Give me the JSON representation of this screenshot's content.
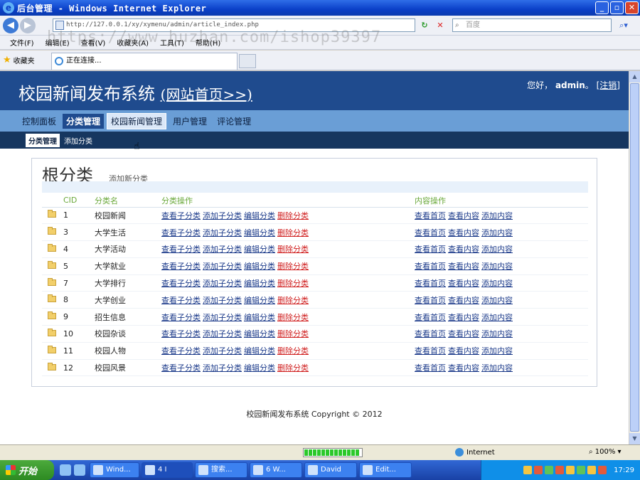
{
  "window": {
    "title": "后台管理 - Windows Internet Explorer",
    "address": "http://127.0.0.1/xy/xymenu/admin/article_index.php",
    "search_placeholder": "百度",
    "watermark": "https://www.huzhan.com/ishop39397",
    "menu": [
      "文件(F)",
      "编辑(E)",
      "查看(V)",
      "收藏夹(A)",
      "工具(T)",
      "帮助(H)"
    ],
    "favorites_label": "收藏夹",
    "tab_label": "正在连接...",
    "status_zone": "Internet",
    "zoom": "100%"
  },
  "site": {
    "title": "校园新闻发布系统",
    "home_link": "(网站首页>>)",
    "greeting": "您好，",
    "user": "admin",
    "logout": "[注销]",
    "nav": [
      "控制面板",
      "分类管理",
      "校园新闻管理",
      "用户管理",
      "评论管理"
    ],
    "subnav": [
      "分类管理",
      "添加分类"
    ],
    "panel_title": "根分类",
    "panel_add": "添加新分类",
    "columns": [
      "CID",
      "分类名",
      "分类操作",
      "内容操作"
    ],
    "cat_actions": [
      "查看子分类",
      "添加子分类",
      "编辑分类",
      "删除分类"
    ],
    "content_actions": [
      "查看首页",
      "查看内容",
      "添加内容"
    ],
    "rows": [
      {
        "cid": "1",
        "name": "校园新闻"
      },
      {
        "cid": "3",
        "name": "大学生活"
      },
      {
        "cid": "4",
        "name": "大学活动"
      },
      {
        "cid": "5",
        "name": "大学就业"
      },
      {
        "cid": "7",
        "name": "大学排行"
      },
      {
        "cid": "8",
        "name": "大学创业"
      },
      {
        "cid": "9",
        "name": "招生信息"
      },
      {
        "cid": "10",
        "name": "校园杂谈"
      },
      {
        "cid": "11",
        "name": "校园人物"
      },
      {
        "cid": "12",
        "name": "校园风景"
      }
    ],
    "footer": "校园新闻发布系统 Copyright © 2012"
  },
  "taskbar": {
    "start": "开始",
    "buttons": [
      "Wind...",
      "4 I",
      "搜索...",
      "6 W...",
      "David",
      "Edit..."
    ],
    "clock": "17:29"
  }
}
